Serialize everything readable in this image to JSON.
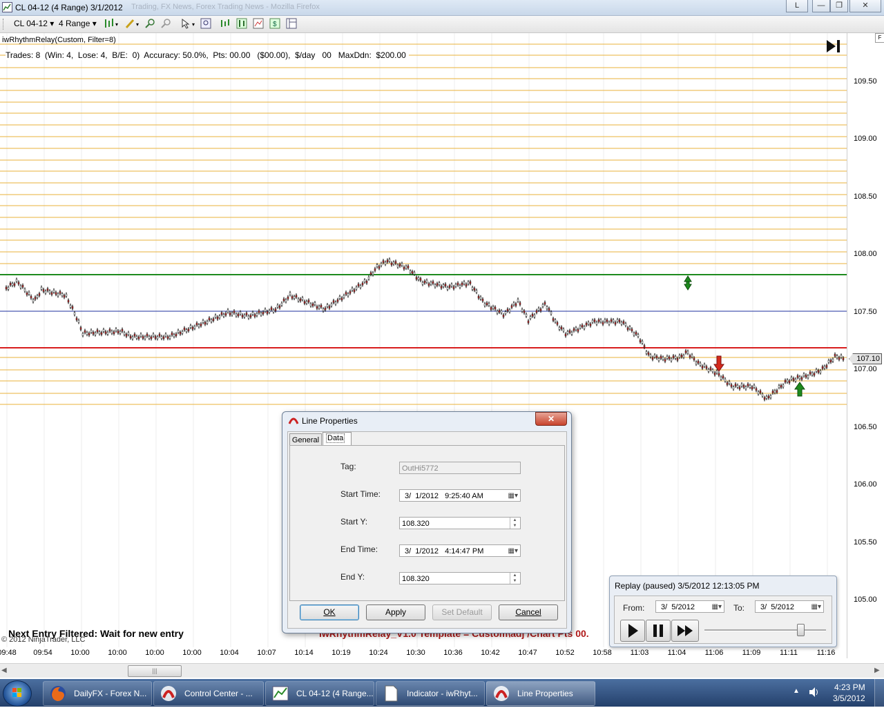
{
  "window": {
    "title": "CL 04-12 (4 Range)  3/1/2012",
    "background_title": "Trading, FX News, Forex Trading News - Mozilla Firefox",
    "lang_indicator": "L"
  },
  "toolbar": {
    "instrument": "CL 04-12",
    "period": "4 Range"
  },
  "chart": {
    "indicator_label": "iwRhythmRelay(Custom, Filter=8)",
    "stats_line": "Trades: 8  (Win: 4,  Lose: 4,  B/E:  0)  Accuracy: 50.0%,  Pts: 00.00   ($00.00),  $/day   00   MaxDdn:  $200.00",
    "bottom_status": "Next Entry Filtered: Wait for new entry",
    "bottom_template": "iwRhythmRelay_V1.0 Template = Custom\\adj /Chart Pts 00.",
    "copyright": "© 2012 NinjaTrader, LLC",
    "current_price_label": "107.10",
    "colors": {
      "grid_orange": "#e8b23a",
      "green_line": "#1e8a1e",
      "blue_line": "#1c2f9c",
      "red_line": "#d81c1c",
      "bar": "#222222"
    }
  },
  "y_axis": {
    "ticks": [
      "109.50",
      "109.00",
      "108.50",
      "108.00",
      "107.50",
      "107.00",
      "106.50",
      "106.00",
      "105.50",
      "105.00"
    ]
  },
  "x_axis": {
    "ticks": [
      "09:48",
      "09:54",
      "10:00",
      "10:00",
      "10:00",
      "10:00",
      "10:04",
      "10:07",
      "10:14",
      "10:19",
      "10:24",
      "10:30",
      "10:36",
      "10:42",
      "10:47",
      "10:52",
      "10:58",
      "11:03",
      "11:04",
      "11:06",
      "11:09",
      "11:11",
      "11:16"
    ]
  },
  "dialog": {
    "title": "Line Properties",
    "tabs": [
      "General",
      "Data"
    ],
    "fields": {
      "tag_label": "Tag:",
      "tag_value": "OutHi5772",
      "start_time_label": "Start Time:",
      "start_time_value": "3/  1/2012   9:25:40 AM",
      "start_y_label": "Start Y:",
      "start_y_value": "108.320",
      "end_time_label": "End Time:",
      "end_time_value": "3/  1/2012   4:14:47 PM",
      "end_y_label": "End Y:",
      "end_y_value": "108.320"
    },
    "buttons": {
      "ok": "OK",
      "apply": "Apply",
      "set_default": "Set Default",
      "cancel": "Cancel"
    }
  },
  "replay": {
    "title": "Replay (paused) 3/5/2012 12:13:05 PM",
    "from_label": "From:",
    "from_value": "3/  5/2012",
    "to_label": "To:",
    "to_value": "3/  5/2012",
    "speed_fraction": 0.8
  },
  "taskbar": {
    "items": [
      {
        "label": "DailyFX - Forex N..."
      },
      {
        "label": "Control Center - ..."
      },
      {
        "label": "CL 04-12 (4 Range..."
      },
      {
        "label": "Indicator - iwRhyt..."
      },
      {
        "label": "Line Properties"
      }
    ],
    "clock_time": "4:23 PM",
    "clock_date": "3/5/2012"
  }
}
